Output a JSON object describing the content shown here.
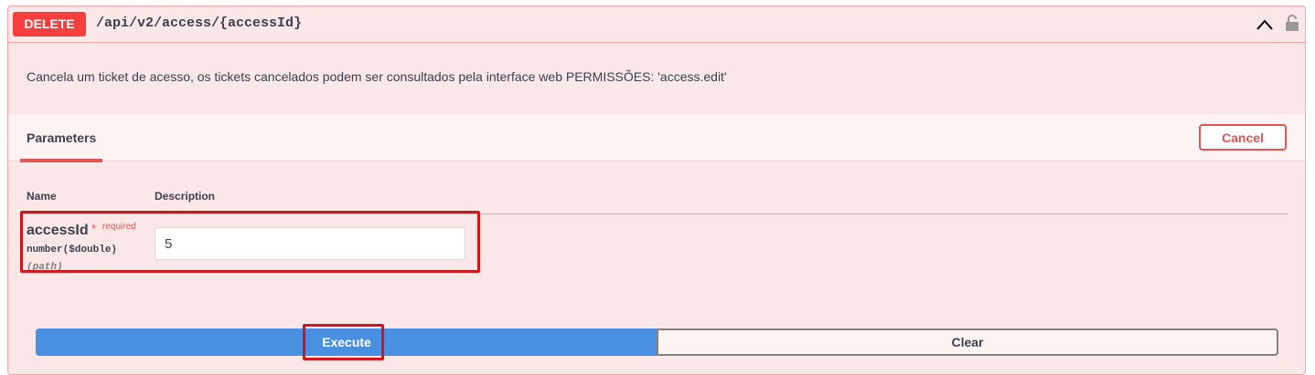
{
  "operation": {
    "method": "DELETE",
    "path": "/api/v2/access/{accessId}",
    "description": "Cancela um ticket de acesso, os tickets cancelados podem ser consultados pela interface web PERMISSÕES: 'access.edit'"
  },
  "tabs": {
    "parameters": "Parameters"
  },
  "buttons": {
    "cancel": "Cancel",
    "execute": "Execute",
    "clear": "Clear"
  },
  "table": {
    "name_header": "Name",
    "description_header": "Description"
  },
  "parameter": {
    "name": "accessId",
    "required_mark": "*",
    "required_label": "required",
    "type": "number($double)",
    "in": "(path)",
    "value": "5"
  },
  "icons": {
    "collapse": "chevron-up-icon",
    "auth": "lock-icon"
  },
  "colors": {
    "delete": "#f93e3e",
    "execute": "#4990e2",
    "accent": "#e45454",
    "highlight": "#d1161b"
  }
}
